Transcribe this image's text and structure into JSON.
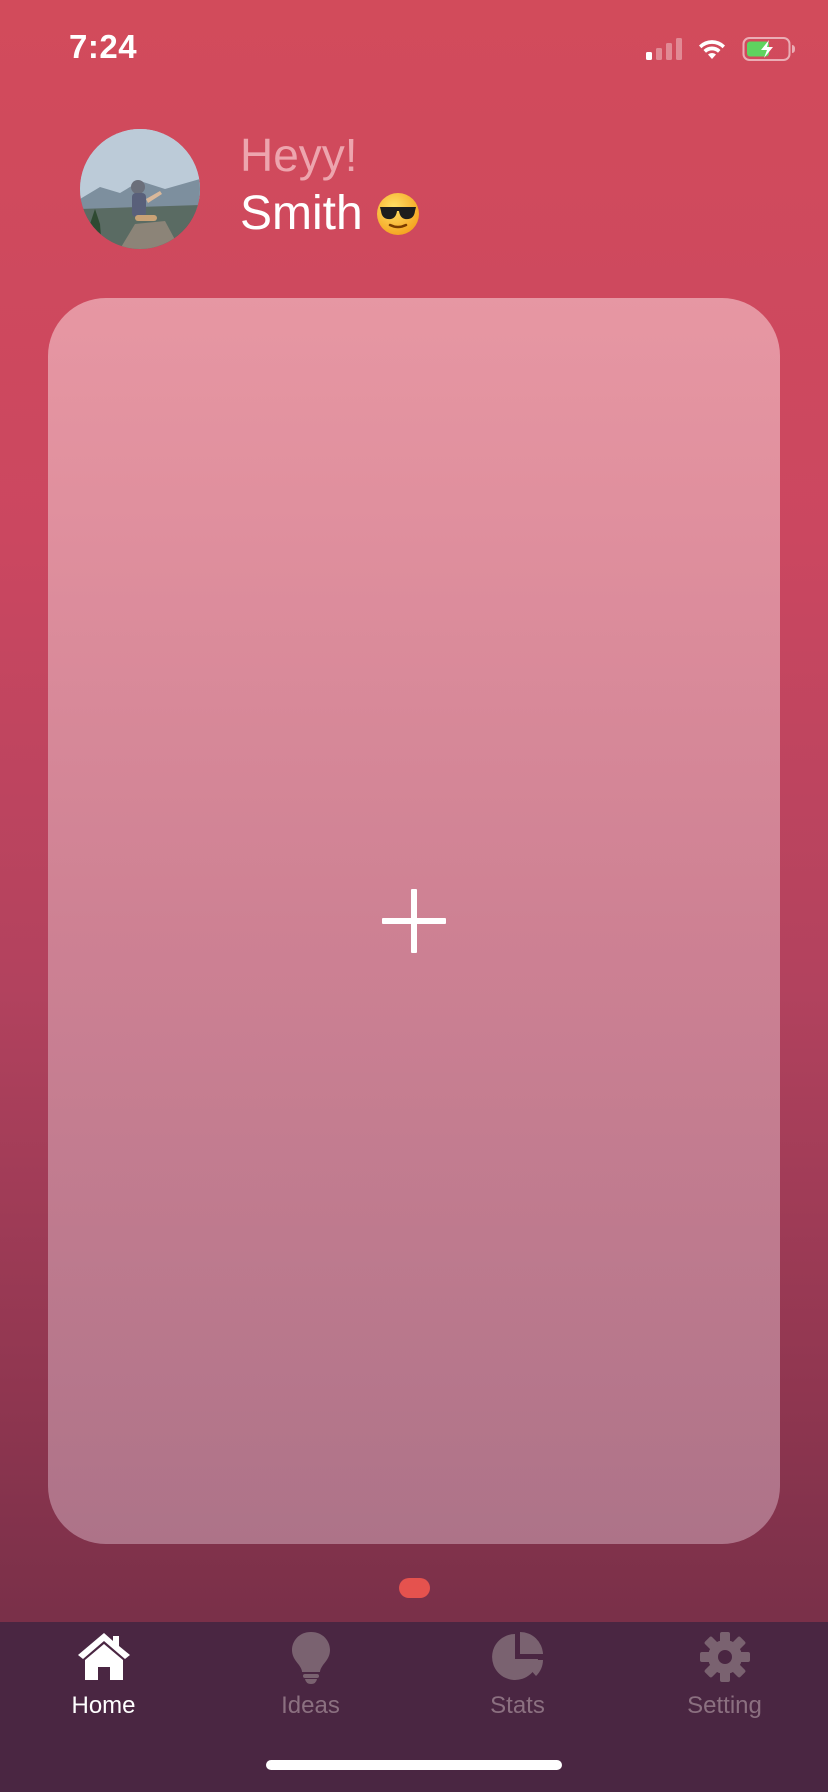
{
  "status_bar": {
    "time": "7:24"
  },
  "header": {
    "greeting": "Heyy!",
    "user_name": "Smith",
    "emoji": "sunglasses-emoji"
  },
  "card": {
    "action_icon": "plus-icon"
  },
  "pager": {
    "current_page": 1,
    "total_pages": 1,
    "active_color": "#e5524e"
  },
  "tabs": [
    {
      "label": "Home",
      "icon": "home-icon",
      "active": true
    },
    {
      "label": "Ideas",
      "icon": "lightbulb-icon",
      "active": false
    },
    {
      "label": "Stats",
      "icon": "pie-chart-icon",
      "active": false
    },
    {
      "label": "Setting",
      "icon": "gear-icon",
      "active": false
    }
  ],
  "colors": {
    "tab_bar_bg": "#4a2642",
    "tab_active": "#ffffff",
    "tab_inactive": "#8b7080",
    "greeting": "#eda5ae"
  }
}
